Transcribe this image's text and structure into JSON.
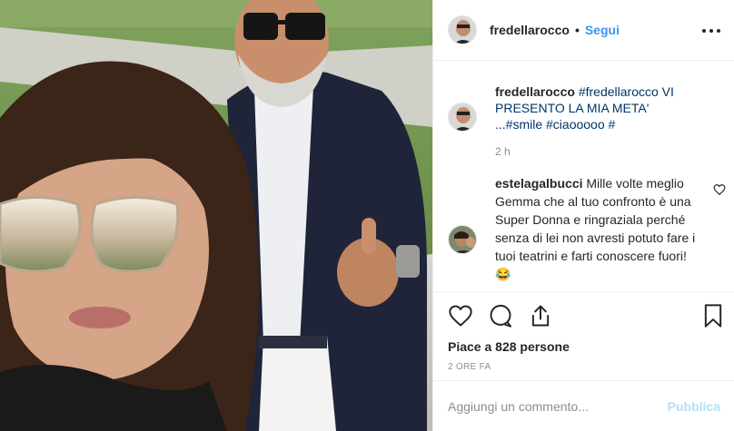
{
  "post": {
    "image_alt": "selfie",
    "author": {
      "username": "fredellarocco",
      "follow_label": "Segui",
      "separator": "•"
    },
    "caption": {
      "username": "fredellarocco",
      "text": "#fredellarocco VI PRESENTO LA MIA META' ...#smile #ciaooooo #",
      "age": "2 h"
    },
    "comments": [
      {
        "username": "estelagalbucci",
        "text": "Mille volte meglio Gemma che al tuo confronto è una Super Donna e ringraziala perché senza di lei non avresti potuto fare i tuoi teatrini e farti conoscere fuori! 😂"
      }
    ],
    "likes_label": "Piace a 828 persone",
    "time_ago": "2 ORE FA",
    "add_comment": {
      "placeholder": "Aggiungi un commento...",
      "publish_label": "Pubblica"
    }
  },
  "icons": [
    "more-options-icon",
    "heart-icon",
    "comment-icon",
    "share-icon",
    "bookmark-icon",
    "small-heart-icon"
  ],
  "colors": {
    "link_blue": "#3897f0",
    "hashtag": "#003569",
    "muted": "#8e8e8e",
    "publish_disabled": "#b2dffc",
    "border": "#efefef"
  }
}
